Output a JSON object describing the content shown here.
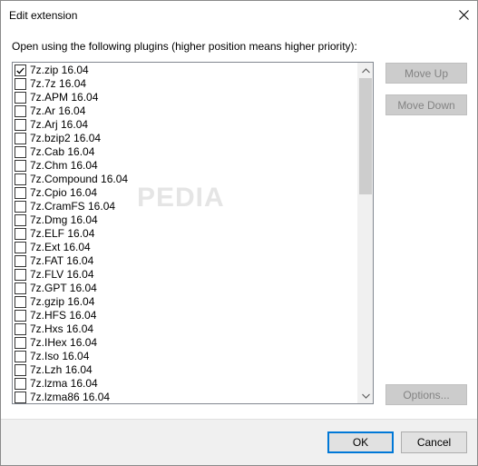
{
  "window": {
    "title": "Edit extension"
  },
  "instruction": "Open using the following plugins (higher position means higher priority):",
  "plugins": [
    {
      "label": "7z.zip 16.04",
      "checked": true
    },
    {
      "label": "7z.7z 16.04",
      "checked": false
    },
    {
      "label": "7z.APM 16.04",
      "checked": false
    },
    {
      "label": "7z.Ar 16.04",
      "checked": false
    },
    {
      "label": "7z.Arj 16.04",
      "checked": false
    },
    {
      "label": "7z.bzip2 16.04",
      "checked": false
    },
    {
      "label": "7z.Cab 16.04",
      "checked": false
    },
    {
      "label": "7z.Chm 16.04",
      "checked": false
    },
    {
      "label": "7z.Compound 16.04",
      "checked": false
    },
    {
      "label": "7z.Cpio 16.04",
      "checked": false
    },
    {
      "label": "7z.CramFS 16.04",
      "checked": false
    },
    {
      "label": "7z.Dmg 16.04",
      "checked": false
    },
    {
      "label": "7z.ELF 16.04",
      "checked": false
    },
    {
      "label": "7z.Ext 16.04",
      "checked": false
    },
    {
      "label": "7z.FAT 16.04",
      "checked": false
    },
    {
      "label": "7z.FLV 16.04",
      "checked": false
    },
    {
      "label": "7z.GPT 16.04",
      "checked": false
    },
    {
      "label": "7z.gzip 16.04",
      "checked": false
    },
    {
      "label": "7z.HFS 16.04",
      "checked": false
    },
    {
      "label": "7z.Hxs 16.04",
      "checked": false
    },
    {
      "label": "7z.IHex 16.04",
      "checked": false
    },
    {
      "label": "7z.Iso 16.04",
      "checked": false
    },
    {
      "label": "7z.Lzh 16.04",
      "checked": false
    },
    {
      "label": "7z.lzma 16.04",
      "checked": false
    },
    {
      "label": "7z.lzma86 16.04",
      "checked": false
    }
  ],
  "side_buttons": {
    "move_up": "Move Up",
    "move_down": "Move Down",
    "options": "Options..."
  },
  "footer": {
    "ok": "OK",
    "cancel": "Cancel"
  },
  "watermark": "PEDIA",
  "colors": {
    "default_button_border": "#0078d7",
    "disabled_button_bg": "#cccccc",
    "disabled_button_text": "#838383"
  },
  "icons": {
    "close": "close-icon",
    "scroll_up": "chevron-up-icon",
    "scroll_down": "chevron-down-icon",
    "check": "checkmark-icon"
  }
}
